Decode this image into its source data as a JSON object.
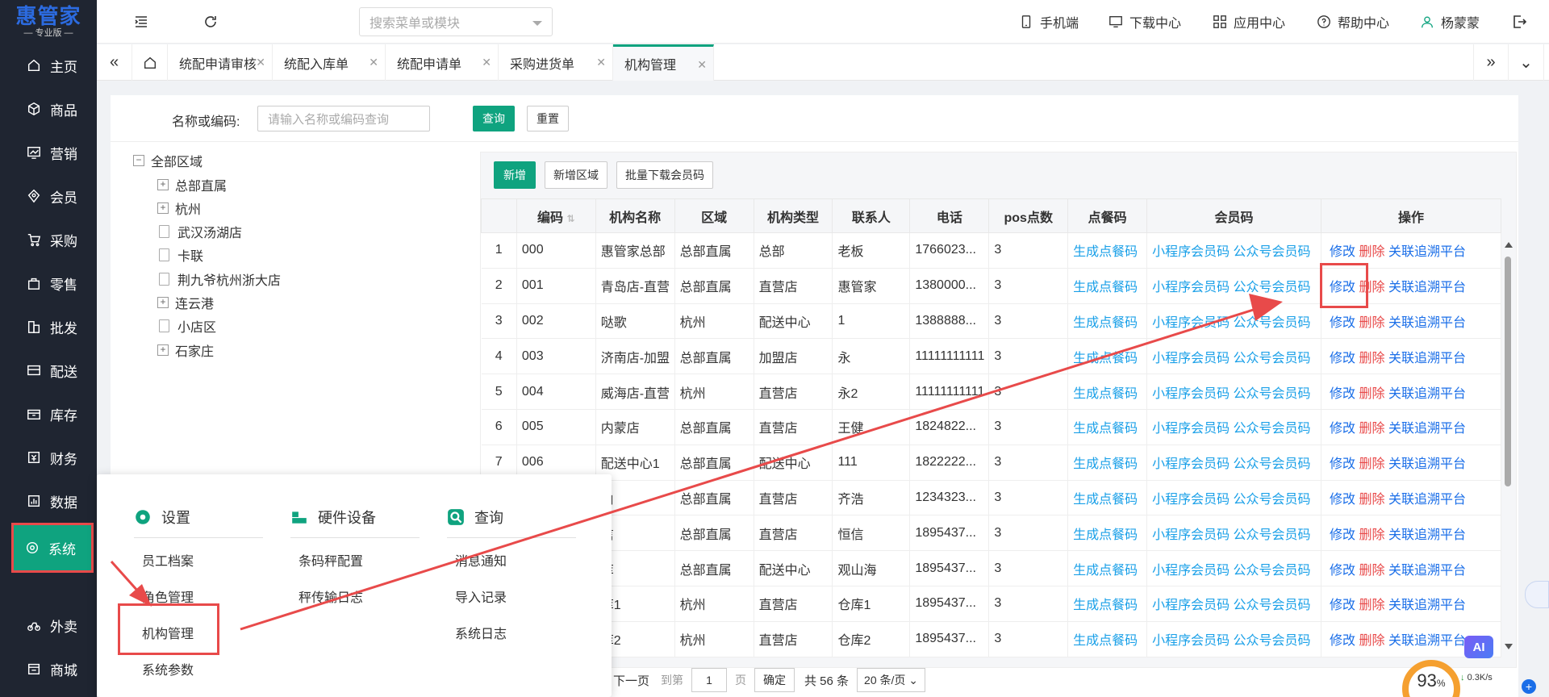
{
  "logo": {
    "name": "惠管家",
    "edition": "— 专业版 —"
  },
  "sidebar": {
    "items": [
      {
        "label": "主页",
        "icon": "home-icon"
      },
      {
        "label": "商品",
        "icon": "cube-icon"
      },
      {
        "label": "营销",
        "icon": "chart-icon"
      },
      {
        "label": "会员",
        "icon": "diamond-icon"
      },
      {
        "label": "采购",
        "icon": "cart-icon"
      },
      {
        "label": "零售",
        "icon": "bag-icon"
      },
      {
        "label": "批发",
        "icon": "building-icon"
      },
      {
        "label": "配送",
        "icon": "truck-icon"
      },
      {
        "label": "库存",
        "icon": "box-icon"
      },
      {
        "label": "财务",
        "icon": "finance-icon"
      },
      {
        "label": "数据",
        "icon": "data-icon"
      },
      {
        "label": "系统",
        "icon": "settings-icon"
      },
      {
        "label": "外卖",
        "icon": "bike-icon"
      },
      {
        "label": "商城",
        "icon": "shop-icon"
      }
    ]
  },
  "topbar": {
    "search_placeholder": "搜索菜单或模块",
    "mobile": "手机端",
    "download": "下载中心",
    "apps": "应用中心",
    "help": "帮助中心",
    "user": "杨蒙蒙"
  },
  "tabs": [
    "统配申请审核",
    "统配入库单",
    "统配申请单",
    "采购进货单",
    "机构管理"
  ],
  "filter": {
    "label": "名称或编码:",
    "placeholder": "请输入名称或编码查询",
    "query": "查询",
    "reset": "重置"
  },
  "tree": {
    "root": "全部区域",
    "nodes": [
      {
        "label": "总部直属",
        "expandable": true
      },
      {
        "label": "杭州",
        "expandable": true
      },
      {
        "label": "武汉汤湖店",
        "expandable": false
      },
      {
        "label": "卡联",
        "expandable": false
      },
      {
        "label": "荆九爷杭州浙大店",
        "expandable": false
      },
      {
        "label": "连云港",
        "expandable": true
      },
      {
        "label": "小店区",
        "expandable": false
      },
      {
        "label": "石家庄",
        "expandable": true
      }
    ]
  },
  "toolbar": {
    "add": "新增",
    "add_region": "新增区域",
    "batch_download": "批量下载会员码"
  },
  "table": {
    "headers": [
      "",
      "编码",
      "机构名称",
      "区域",
      "机构类型",
      "联系人",
      "电话",
      "pos点数",
      "点餐码",
      "会员码",
      "操作"
    ],
    "link_order": "生成点餐码",
    "link_mini": "小程序会员码",
    "link_public": "公众号会员码",
    "op_edit": "修改",
    "op_delete": "删除",
    "op_trace": "关联追溯平台",
    "rows": [
      [
        "1",
        "000",
        "惠管家总部",
        "总部直属",
        "总部",
        "老板",
        "1766023...",
        "3"
      ],
      [
        "2",
        "001",
        "青岛店-直营",
        "总部直属",
        "直营店",
        "惠管家",
        "1380000...",
        "3"
      ],
      [
        "3",
        "002",
        "哒歌",
        "杭州",
        "配送中心",
        "1",
        "1388888...",
        "3"
      ],
      [
        "4",
        "003",
        "济南店-加盟",
        "总部直属",
        "加盟店",
        "永",
        "11111111111",
        "3"
      ],
      [
        "5",
        "004",
        "威海店-直营",
        "杭州",
        "直营店",
        "永2",
        "11111111111",
        "3"
      ],
      [
        "6",
        "005",
        "内蒙店",
        "总部直属",
        "直营店",
        "王健",
        "1824822...",
        "3"
      ],
      [
        "7",
        "006",
        "配送中心1",
        "总部直属",
        "配送中心",
        "111",
        "1822222...",
        "3"
      ],
      [
        "",
        "",
        "山",
        "总部直属",
        "直营店",
        "齐浩",
        "1234323...",
        "3"
      ],
      [
        "",
        "",
        "信",
        "总部直属",
        "直营店",
        "恒信",
        "1895437...",
        "3"
      ],
      [
        "",
        "",
        "库",
        "总部直属",
        "配送中心",
        "观山海",
        "1895437...",
        "3"
      ],
      [
        "",
        "",
        "库1",
        "杭州",
        "直营店",
        "仓库1",
        "1895437...",
        "3"
      ],
      [
        "",
        "",
        "库2",
        "杭州",
        "直营店",
        "仓库2",
        "1895437...",
        "3"
      ]
    ]
  },
  "menu": {
    "settings": {
      "title": "设置",
      "items": [
        "员工档案",
        "角色管理",
        "机构管理",
        "系统参数"
      ]
    },
    "hardware": {
      "title": "硬件设备",
      "items": [
        "条码秤配置",
        "秤传输日志"
      ]
    },
    "query": {
      "title": "查询",
      "items": [
        "消息通知",
        "导入记录",
        "系统日志"
      ]
    }
  },
  "pager": {
    "next": "下一页",
    "goto": "到第",
    "page": "1",
    "page_unit": "页",
    "confirm": "确定",
    "total": "共 56 条",
    "size": "20 条/页"
  },
  "status": {
    "cpu": "93",
    "cpu_unit": "%",
    "net": "0.3K/s"
  },
  "ai_badge": "AI",
  "colors": {
    "brand": "#0fa37f",
    "sidebar": "#1f2531",
    "highlight": "#e84a4a",
    "link": "#1aa0e8"
  }
}
